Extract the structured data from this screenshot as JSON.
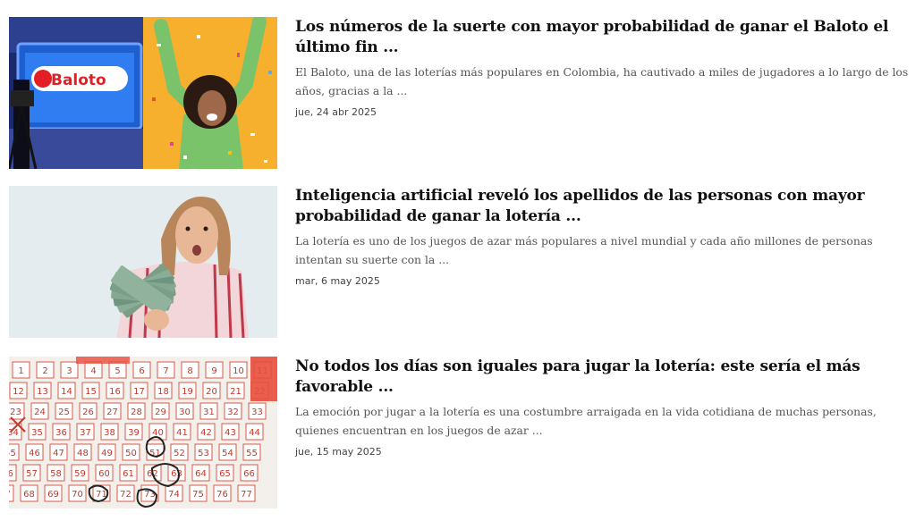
{
  "articles": [
    {
      "title": "Los números de la suerte con mayor probabilidad de ganar el Baloto el último fin ...",
      "summary": "El Baloto, una de las loterías más populares en Colombia, ha cautivado a miles de jugadores a lo largo de los años, gracias a la ...",
      "date": "jue, 24 abr 2025",
      "image_logo_text": "Baloto"
    },
    {
      "title": "Inteligencia artificial reveló los apellidos de las personas con mayor probabilidad de ganar la lotería ...",
      "summary": "La lotería es uno de los juegos de azar más populares a nivel mundial y cada año millones de personas intentan su suerte con la ...",
      "date": "mar, 6 may 2025"
    },
    {
      "title": "No todos los días son iguales para jugar la lotería: este sería el más favorable ...",
      "summary": "La emoción por jugar a la lotería es una costumbre arraigada en la vida cotidiana de muchas personas, quienes encuentran en los juegos de azar ...",
      "date": "jue, 15 may 2025"
    }
  ]
}
